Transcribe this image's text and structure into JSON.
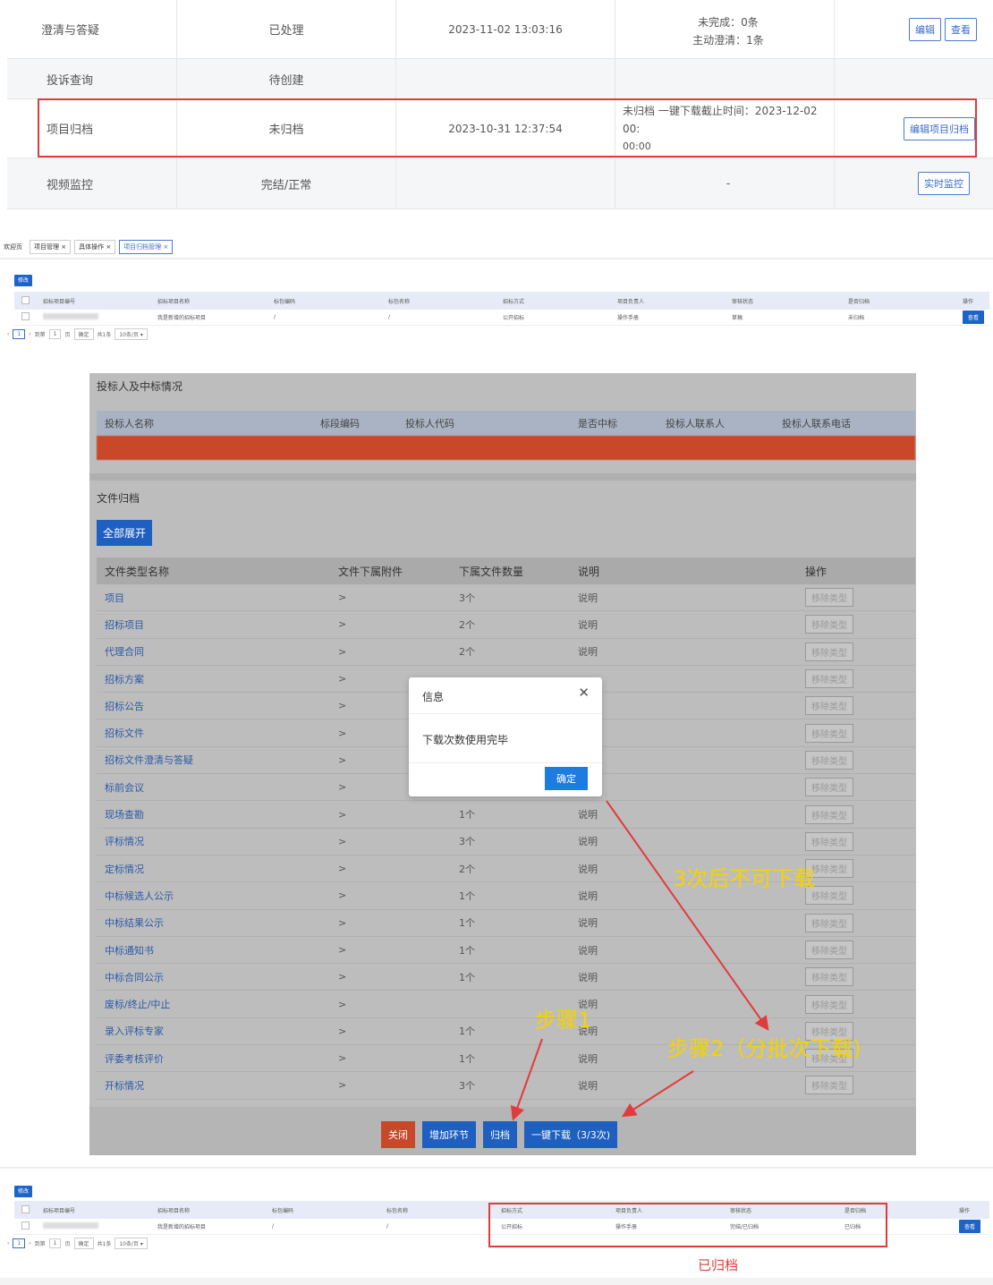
{
  "top_table": {
    "rows": [
      {
        "type": "澄清与答疑",
        "status": "已处理",
        "time": "2023-11-02 13:03:16",
        "desc_lines": [
          "未完成：0条",
          "主动澄清：1条"
        ],
        "buttons": [
          "编辑",
          "查看"
        ]
      },
      {
        "type": "投诉查询",
        "status": "待创建",
        "time": "",
        "desc_lines": [],
        "buttons": []
      },
      {
        "type": "项目归档",
        "status": "未归档",
        "time": "2023-10-31 12:37:54",
        "desc_lines": [
          "未归档 一键下载截止时间：2023-12-02 00:",
          "00:00"
        ],
        "buttons": [
          "编辑项目归档"
        ]
      },
      {
        "type": "视频监控",
        "status": "完结/正常",
        "time": "",
        "desc_lines": [
          "-"
        ],
        "buttons": [
          "实时监控"
        ]
      }
    ]
  },
  "tabs": [
    "欢迎页",
    "项目管理 ×",
    "具体操作 ×",
    "项目归档管理 ×"
  ],
  "list1": {
    "edit": "修改",
    "headers": [
      "招标项目编号",
      "招标项目名称",
      "标包编码",
      "标包名称",
      "招标方式",
      "项目负责人",
      "审核状态",
      "是否归档",
      "操作"
    ],
    "row": [
      "",
      "我是新增的招标项目",
      "/",
      "/",
      "公开招标",
      "操作手册",
      "草稿",
      "未归档",
      "查看"
    ],
    "pager": {
      "page": "1",
      "goto": "到第",
      "input": "1",
      "page_unit": "页",
      "confirm": "确定",
      "total": "共1条",
      "per_page": "10条/页"
    }
  },
  "modal": {
    "bidder_title": "投标人及中标情况",
    "bidder_headers": [
      "投标人名称",
      "标段编码",
      "投标人代码",
      "是否中标",
      "投标人联系人",
      "投标人联系电话"
    ],
    "file_title": "文件归档",
    "expand": "全部展开",
    "file_headers": [
      "文件类型名称",
      "文件下属附件",
      "下属文件数量",
      "说明",
      "操作"
    ],
    "files": [
      {
        "name": "项目",
        "count": "3个",
        "desc": "说明"
      },
      {
        "name": "招标项目",
        "count": "2个",
        "desc": "说明"
      },
      {
        "name": "代理合同",
        "count": "2个",
        "desc": "说明"
      },
      {
        "name": "招标方案",
        "count": "",
        "desc": ""
      },
      {
        "name": "招标公告",
        "count": "",
        "desc": ""
      },
      {
        "name": "招标文件",
        "count": "",
        "desc": ""
      },
      {
        "name": "招标文件澄清与答疑",
        "count": "",
        "desc": ""
      },
      {
        "name": "标前会议",
        "count": "",
        "desc": ""
      },
      {
        "name": "现场查勘",
        "count": "1个",
        "desc": "说明"
      },
      {
        "name": "评标情况",
        "count": "3个",
        "desc": "说明"
      },
      {
        "name": "定标情况",
        "count": "2个",
        "desc": "说明"
      },
      {
        "name": "中标候选人公示",
        "count": "1个",
        "desc": "说明"
      },
      {
        "name": "中标结果公示",
        "count": "1个",
        "desc": "说明"
      },
      {
        "name": "中标通知书",
        "count": "1个",
        "desc": "说明"
      },
      {
        "name": "中标合同公示",
        "count": "1个",
        "desc": "说明"
      },
      {
        "name": "废标/终止/中止",
        "count": "",
        "desc": "说明"
      },
      {
        "name": "录入评标专家",
        "count": "1个",
        "desc": "说明"
      },
      {
        "name": "评委考核评价",
        "count": "1个",
        "desc": "说明"
      },
      {
        "name": "开标情况",
        "count": "3个",
        "desc": "说明"
      }
    ],
    "arrow": ">",
    "remove": "移除类型",
    "dialog": {
      "title": "信息",
      "message": "下载次数使用完毕",
      "ok": "确定"
    },
    "footer": {
      "close": "关闭",
      "add": "增加环节",
      "archive": "归档",
      "download": "一键下载（3/3次)"
    },
    "annotations": {
      "no_download": "3次后不可下载",
      "step1": "步骤1",
      "step2": "步骤2（分批次下载)"
    }
  },
  "list2": {
    "edit": "修改",
    "row": [
      "",
      "我是新增的招标项目",
      "/",
      "/",
      "公开招标",
      "操作手册",
      "完结/已归档",
      "已归档",
      "查看"
    ],
    "note": "已归档"
  },
  "colors": {
    "primary": "#1e63c7",
    "red": "#e23b3b",
    "annotation": "#f5d300",
    "close_btn": "#c9482a"
  }
}
